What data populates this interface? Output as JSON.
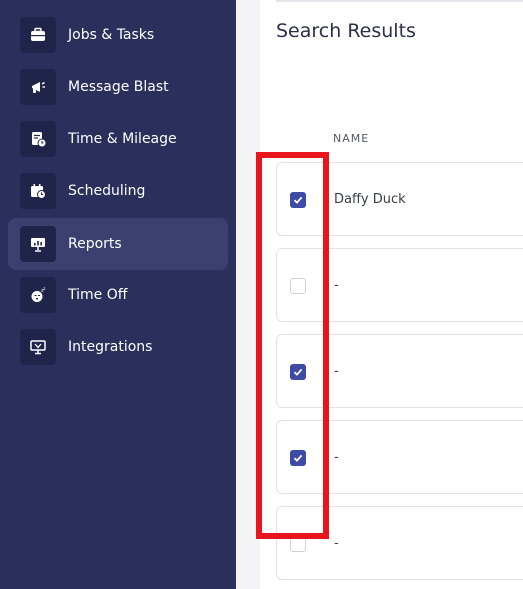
{
  "sidebar": {
    "items": [
      {
        "label": "Jobs & Tasks",
        "icon": "briefcase-icon",
        "active": false
      },
      {
        "label": "Message Blast",
        "icon": "megaphone-icon",
        "active": false
      },
      {
        "label": "Time & Mileage",
        "icon": "timesheet-icon",
        "active": false
      },
      {
        "label": "Scheduling",
        "icon": "calendar-clock-icon",
        "active": false
      },
      {
        "label": "Reports",
        "icon": "presentation-chart-icon",
        "active": true
      },
      {
        "label": "Time Off",
        "icon": "sleep-face-icon",
        "active": false
      },
      {
        "label": "Integrations",
        "icon": "monitor-icon",
        "active": false
      }
    ]
  },
  "main": {
    "title": "Search Results",
    "column_header": "NAME",
    "rows": [
      {
        "name": "Daffy Duck",
        "checked": true
      },
      {
        "name": "-",
        "checked": false
      },
      {
        "name": "-",
        "checked": true
      },
      {
        "name": "-",
        "checked": true
      },
      {
        "name": "-",
        "checked": false
      }
    ]
  },
  "colors": {
    "sidebar_bg": "#2b2f5c",
    "active_item_bg": "#3c4070",
    "checkbox_checked": "#3d4aa6",
    "highlight_box": "#e8161c"
  }
}
